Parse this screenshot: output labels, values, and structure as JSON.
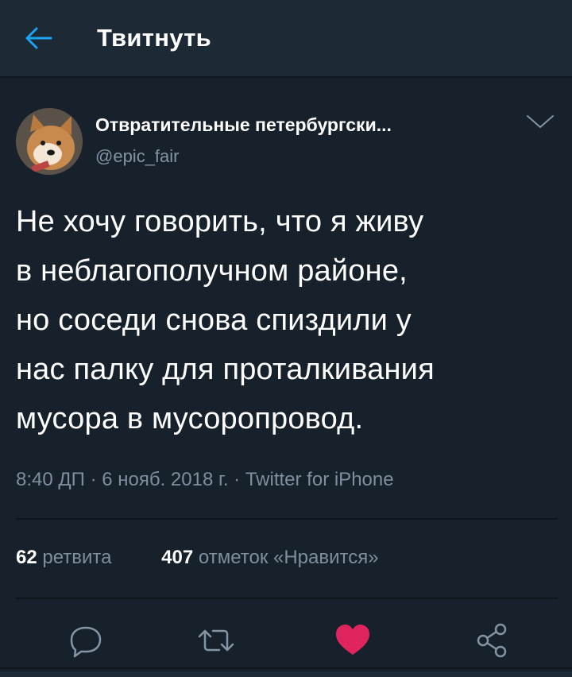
{
  "header": {
    "title": "Твитнуть",
    "back_icon": "arrow-left-icon"
  },
  "tweet": {
    "author_name": "Отвратительные петербургски...",
    "author_handle": "@epic_fair",
    "text_lines": [
      "Не хочу говорить, что я живу",
      "в неблагополучном районе,",
      "но соседи снова спиздили у",
      "нас палку для проталкивания",
      "мусора в мусоропровод."
    ],
    "time": "8:40 ДП",
    "date": "6 нояб. 2018 г.",
    "source": "Twitter for iPhone",
    "separator": "·"
  },
  "stats": {
    "retweets_count": "62",
    "retweets_label": "ретвита",
    "likes_count": "407",
    "likes_label": "отметок «Нравится»"
  },
  "actions": {
    "reply_icon": "reply-icon",
    "retweet_icon": "retweet-icon",
    "like_icon": "heart-icon",
    "share_icon": "share-icon"
  },
  "colors": {
    "background": "#17212b",
    "header": "#1d2a36",
    "accent": "#1da1f2",
    "muted": "#7e8f9f",
    "like": "#e0245e"
  }
}
